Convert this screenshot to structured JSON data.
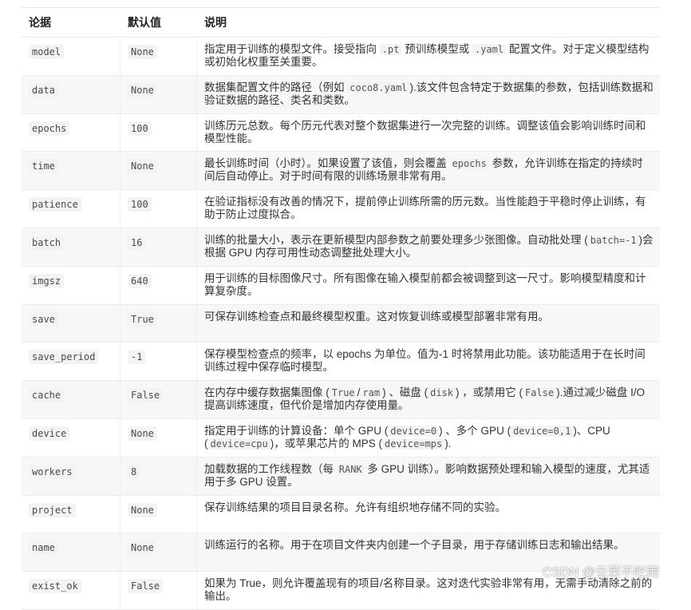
{
  "headers": {
    "param": "论据",
    "default": "默认值",
    "desc": "说明"
  },
  "rows": [
    {
      "param": "model",
      "default": "None",
      "desc": [
        {
          "t": "指定用于训练的模型文件。接受指向 "
        },
        {
          "c": ".pt"
        },
        {
          "t": " 预训练模型或 "
        },
        {
          "c": ".yaml"
        },
        {
          "t": " 配置文件。对于定义模型结构或初始化权重至关重要。"
        }
      ]
    },
    {
      "param": "data",
      "default": "None",
      "desc": [
        {
          "t": "数据集配置文件的路径（例如 "
        },
        {
          "c": "coco8.yaml"
        },
        {
          "t": ").该文件包含特定于数据集的参数，包括训练数据和验证数据的路径、类名和类数。"
        }
      ]
    },
    {
      "param": "epochs",
      "default": "100",
      "desc": [
        {
          "t": "训练历元总数。每个历元代表对整个数据集进行一次完整的训练。调整该值会影响训练时间和模型性能。"
        }
      ]
    },
    {
      "param": "time",
      "default": "None",
      "desc": [
        {
          "t": "最长训练时间（小时）。如果设置了该值，则会覆盖 "
        },
        {
          "c": "epochs"
        },
        {
          "t": " 参数，允许训练在指定的持续时间后自动停止。对于时间有限的训练场景非常有用。"
        }
      ]
    },
    {
      "param": "patience",
      "default": "100",
      "desc": [
        {
          "t": "在验证指标没有改善的情况下，提前停止训练所需的历元数。当性能趋于平稳时停止训练，有助于防止过度拟合。"
        }
      ]
    },
    {
      "param": "batch",
      "default": "16",
      "desc": [
        {
          "t": "训练的批量大小，表示在更新模型内部参数之前要处理多少张图像。自动批处理 ("
        },
        {
          "c": "batch=-1"
        },
        {
          "t": ")会根据 GPU 内存可用性动态调整批处理大小。"
        }
      ]
    },
    {
      "param": "imgsz",
      "default": "640",
      "desc": [
        {
          "t": "用于训练的目标图像尺寸。所有图像在输入模型前都会被调整到这一尺寸。影响模型精度和计算复杂度。"
        }
      ]
    },
    {
      "param": "save",
      "default": "True",
      "desc": [
        {
          "t": "可保存训练检查点和最终模型权重。这对恢复训练或模型部署非常有用。"
        }
      ]
    },
    {
      "param": "save_period",
      "default": "-1",
      "desc": [
        {
          "t": "保存模型检查点的频率，以 epochs 为单位。值为-1 时将禁用此功能。该功能适用于在长时间训练过程中保存临时模型。"
        }
      ]
    },
    {
      "param": "cache",
      "default": "False",
      "desc": [
        {
          "t": "在内存中缓存数据集图像 ("
        },
        {
          "c": "True"
        },
        {
          "t": "/"
        },
        {
          "c": "ram"
        },
        {
          "t": ") 、磁盘 ("
        },
        {
          "c": "disk"
        },
        {
          "t": ") ，或禁用它 ("
        },
        {
          "c": "False"
        },
        {
          "t": ").通过减少磁盘 I/O 提高训练速度，但代价是增加内存使用量。"
        }
      ]
    },
    {
      "param": "device",
      "default": "None",
      "desc": [
        {
          "t": "指定用于训练的计算设备：单个 GPU ("
        },
        {
          "c": "device=0"
        },
        {
          "t": ") 、多个 GPU ("
        },
        {
          "c": "device=0,1"
        },
        {
          "t": ")、CPU ("
        },
        {
          "c": "device=cpu"
        },
        {
          "t": ")，或苹果芯片的 MPS ("
        },
        {
          "c": "device=mps"
        },
        {
          "t": ")."
        }
      ]
    },
    {
      "param": "workers",
      "default": "8",
      "desc": [
        {
          "t": "加载数据的工作线程数（每 "
        },
        {
          "c": "RANK"
        },
        {
          "t": " 多 GPU 训练）。影响数据预处理和输入模型的速度，尤其适用于多 GPU 设置。"
        }
      ]
    },
    {
      "param": "project",
      "default": "None",
      "desc": [
        {
          "t": "保存训练结果的项目目录名称。允许有组织地存储不同的实验。"
        }
      ]
    },
    {
      "param": "name",
      "default": "None",
      "desc": [
        {
          "t": "训练运行的名称。用于在项目文件夹内创建一个子目录，用于存储训练日志和输出结果。"
        }
      ]
    },
    {
      "param": "exist_ok",
      "default": "False",
      "desc": [
        {
          "t": "如果为 True，则允许覆盖现有的项目/名称目录。这对迭代实验非常有用，无需手动清除之前的输出。"
        }
      ]
    }
  ],
  "watermark": "CSDN @云菜不吃雨"
}
